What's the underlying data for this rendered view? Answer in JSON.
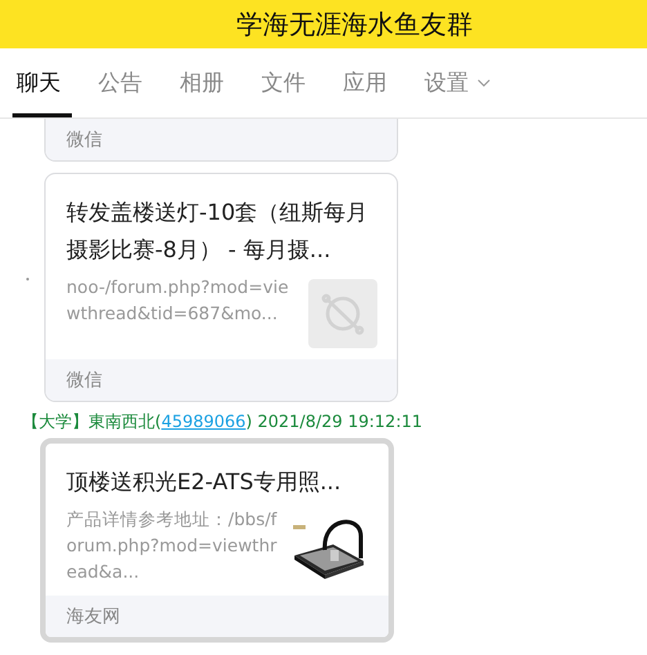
{
  "header": {
    "title": "学海无涯海水鱼友群"
  },
  "tabs": [
    {
      "label": "聊天",
      "selected": true,
      "dropdown": false
    },
    {
      "label": "公告",
      "selected": false,
      "dropdown": false
    },
    {
      "label": "相册",
      "selected": false,
      "dropdown": false
    },
    {
      "label": "文件",
      "selected": false,
      "dropdown": false
    },
    {
      "label": "应用",
      "selected": false,
      "dropdown": false
    },
    {
      "label": "设置",
      "selected": false,
      "dropdown": true
    }
  ],
  "messages": [
    {
      "cut_top": true,
      "highlighted": false,
      "card": {
        "source": "微信"
      }
    },
    {
      "cut_top": false,
      "highlighted": false,
      "card": {
        "title": "转发盖楼送灯-10套（纽斯每月摄影比赛-8月） - 每月摄...",
        "description": "noo-/forum.php?mod=viewthread&tid=687&mo...",
        "thumbnail": {
          "kind": "placeholder"
        },
        "source": "微信"
      }
    },
    {
      "cut_top": false,
      "highlighted": true,
      "sender": {
        "prefix": "【大学】東南西北(",
        "id": "45989066",
        "suffix": ") 2021/8/29 19:12:11"
      },
      "card": {
        "title": "顶楼送积光E2-ATS专用照...",
        "description": "产品详情参考地址：/bbs/forum.php?mod=viewthread&a...",
        "source": "海友网"
      }
    }
  ]
}
